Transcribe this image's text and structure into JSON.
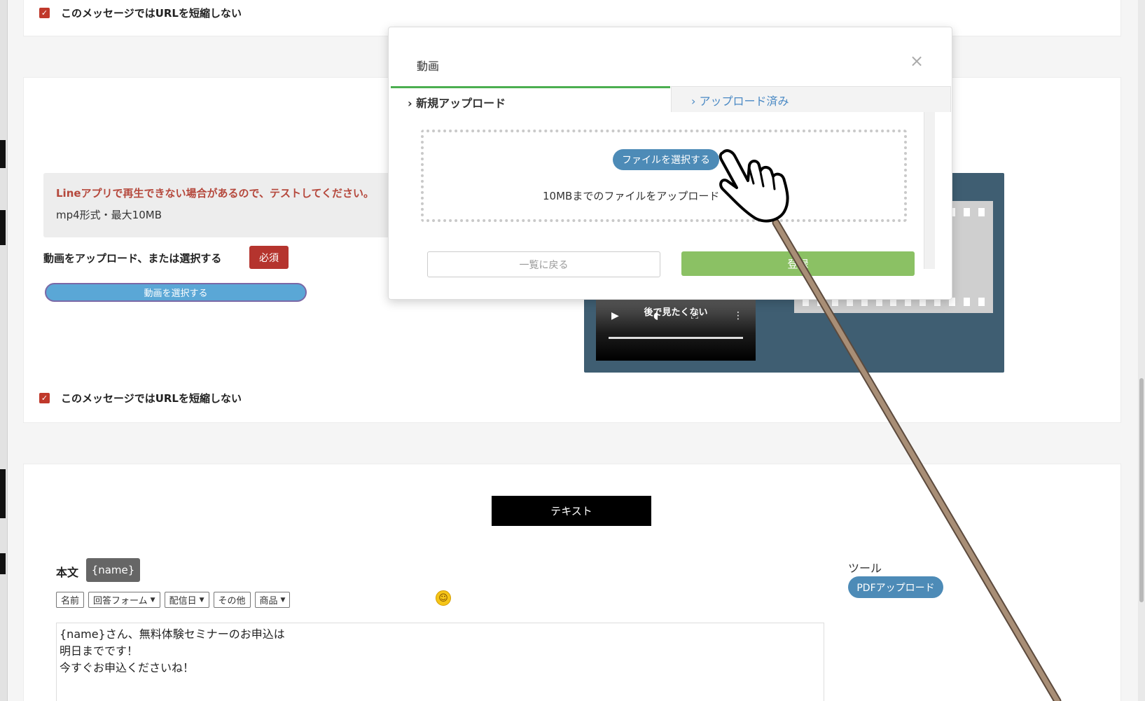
{
  "top_card": {
    "no_shorten_label": "このメッセージではURLを短縮しない"
  },
  "video_card": {
    "warning": "Lineアプリで再生できない場合があるので、テストしてください。",
    "spec": "mp4形式・最大10MB",
    "upload_label": "動画をアップロード、または選択する",
    "required": "必須",
    "select_button": "動画を選択する",
    "preview_caption": "後で見たくない",
    "no_shorten_label": "このメッセージではURLを短縮しない"
  },
  "modal": {
    "title": "動画",
    "close": "×",
    "tabs": [
      {
        "label": "新規アップロード",
        "active": true
      },
      {
        "label": "アップロード済み",
        "active": false
      }
    ],
    "choose_file_button": "ファイルを選択する",
    "drop_text": "10MBまでのファイルをアップロード",
    "back_button": "一覧に戻る",
    "register_button": "登録",
    "colors": {
      "tab_active": "#4caf50",
      "register": "#8bc164",
      "choose": "#4d8bb7"
    }
  },
  "text_card": {
    "header": "テキスト",
    "body_label": "本文",
    "name_badge": "{name}",
    "toolbar": [
      {
        "label": "名前",
        "caret": false
      },
      {
        "label": "回答フォーム",
        "caret": true
      },
      {
        "label": "配信日",
        "caret": true
      },
      {
        "label": "その他",
        "caret": false
      },
      {
        "label": "商品",
        "caret": true
      }
    ],
    "emoji_icon": "smiley-icon",
    "body_lines": [
      "{name}さん、無料体験セミナーのお申込は",
      "明日までです！",
      "",
      "今すぐお申込くださいね！"
    ],
    "tools_label": "ツール",
    "pdf_button": "PDFアップロード"
  },
  "icons": {
    "cursor": "hand-pointer-icon",
    "play": "play-icon",
    "volume": "volume-icon",
    "fullscreen": "fullscreen-icon",
    "more": "more-vertical-icon"
  }
}
